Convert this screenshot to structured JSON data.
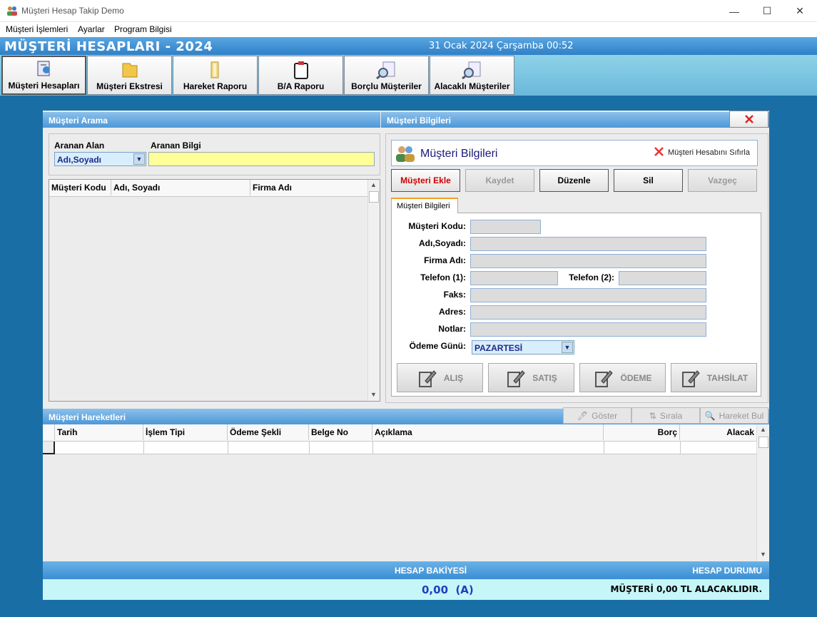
{
  "window": {
    "title": "Müşteri Hesap Takip Demo",
    "minimize": "—",
    "maximize": "☐",
    "close": "✕"
  },
  "menu": [
    "Müşteri İşlemleri",
    "Ayarlar",
    "Program Bilgisi"
  ],
  "header": {
    "title": "MÜŞTERİ HESAPLARI - 2024",
    "datetime": "31 Ocak 2024 Çarşamba 00:52"
  },
  "toolbar": [
    {
      "label": "Müşteri Hesapları",
      "icon": "customer-accounts-icon"
    },
    {
      "label": "Müşteri Ekstresi",
      "icon": "folder-icon"
    },
    {
      "label": "Hareket Raporu",
      "icon": "report-folder-icon"
    },
    {
      "label": "B/A Raporu",
      "icon": "clipboard-icon"
    },
    {
      "label": "Borçlu Müşteriler",
      "icon": "search-document-icon"
    },
    {
      "label": "Alacaklı Müşteriler",
      "icon": "search-document-icon"
    }
  ],
  "search_panel": {
    "title": "Müşteri Arama",
    "field_label": "Aranan Alan",
    "field_value": "Adı,Soyadı",
    "info_label": "Aranan Bilgi",
    "info_value": "",
    "columns": [
      "Müşteri Kodu",
      "Adı, Soyadı",
      "Firma Adı"
    ]
  },
  "info_panel": {
    "title": "Müşteri Bilgileri",
    "heading": "Müşteri Bilgileri",
    "reset_label": "Müşteri Hesabını Sıfırla",
    "buttons": {
      "add": "Müşteri Ekle",
      "save": "Kaydet",
      "edit": "Düzenle",
      "delete": "Sil",
      "cancel": "Vazgeç"
    },
    "tab": "Müşteri Bilgileri",
    "labels": {
      "code": "Müşteri Kodu:",
      "name": "Adı,Soyadı:",
      "company": "Firma Adı:",
      "phone1": "Telefon (1):",
      "phone2": "Telefon (2):",
      "fax": "Faks:",
      "address": "Adres:",
      "notes": "Notlar:",
      "payday": "Ödeme Günü:"
    },
    "payday_value": "PAZARTESİ",
    "actions": [
      "ALIŞ",
      "SATIŞ",
      "ÖDEME",
      "TAHSİLAT"
    ]
  },
  "movements": {
    "title": "Müşteri Hareketleri",
    "tools": [
      "Göster",
      "Sırala",
      "Hareket Bul"
    ],
    "columns": [
      "Tarih",
      "İşlem Tipi",
      "Ödeme Şekli",
      "Belge No",
      "Açıklama",
      "Borç",
      "Alacak"
    ]
  },
  "footer": {
    "balance_label": "HESAP BAKİYESİ",
    "status_label": "HESAP DURUMU",
    "balance_value": "0,00  (A)",
    "status_value": "MÜŞTERİ 0,00 TL ALACAKLIDIR."
  },
  "colors": {
    "accent": "#2f80c8",
    "highlight": "#ffff99",
    "footer": "#c6f6f8",
    "balance": "#1f3fbf",
    "add_button": "#cc0000"
  }
}
